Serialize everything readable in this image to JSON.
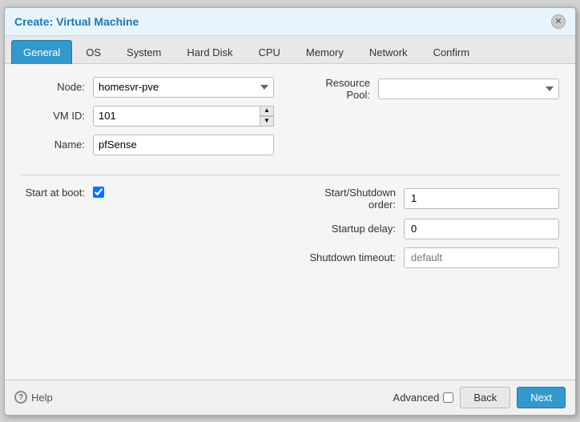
{
  "dialog": {
    "title": "Create: Virtual Machine",
    "close_label": "×"
  },
  "tabs": [
    {
      "id": "general",
      "label": "General",
      "active": true
    },
    {
      "id": "os",
      "label": "OS",
      "active": false
    },
    {
      "id": "system",
      "label": "System",
      "active": false
    },
    {
      "id": "harddisk",
      "label": "Hard Disk",
      "active": false
    },
    {
      "id": "cpu",
      "label": "CPU",
      "active": false
    },
    {
      "id": "memory",
      "label": "Memory",
      "active": false
    },
    {
      "id": "network",
      "label": "Network",
      "active": false
    },
    {
      "id": "confirm",
      "label": "Confirm",
      "active": false
    }
  ],
  "form": {
    "node_label": "Node:",
    "node_value": "homesvr-pve",
    "vmid_label": "VM ID:",
    "vmid_value": "101",
    "name_label": "Name:",
    "name_value": "pfSense",
    "resource_pool_label": "Resource Pool:",
    "resource_pool_value": "",
    "resource_pool_placeholder": "",
    "start_at_boot_label": "Start at boot:",
    "start_shutdown_label": "Start/Shutdown order:",
    "start_shutdown_value": "1",
    "startup_delay_label": "Startup delay:",
    "startup_delay_value": "0",
    "shutdown_timeout_label": "Shutdown timeout:",
    "shutdown_timeout_placeholder": "default"
  },
  "footer": {
    "help_label": "Help",
    "advanced_label": "Advanced",
    "back_label": "Back",
    "next_label": "Next"
  },
  "icons": {
    "question": "?",
    "close": "✕",
    "chevron_down": "▼",
    "spinner_up": "▲",
    "spinner_down": "▼"
  }
}
